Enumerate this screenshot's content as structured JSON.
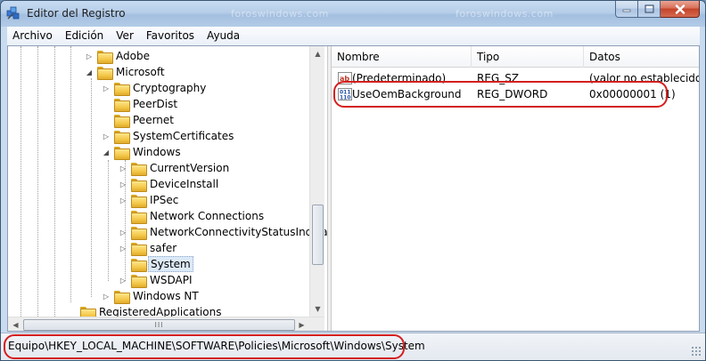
{
  "window": {
    "title": "Editor del Registro",
    "watermark": "foroswindows.com"
  },
  "menu": [
    "Archivo",
    "Edición",
    "Ver",
    "Favoritos",
    "Ayuda"
  ],
  "tree": {
    "items": [
      {
        "label": "Adobe",
        "expander": "collapsed",
        "selected": false
      },
      {
        "label": "Microsoft",
        "expander": "expanded",
        "selected": false
      },
      {
        "label": "Cryptography",
        "expander": "collapsed",
        "selected": false
      },
      {
        "label": "PeerDist",
        "expander": "none",
        "selected": false
      },
      {
        "label": "Peernet",
        "expander": "none",
        "selected": false
      },
      {
        "label": "SystemCertificates",
        "expander": "collapsed",
        "selected": false
      },
      {
        "label": "Windows",
        "expander": "expanded",
        "selected": false
      },
      {
        "label": "CurrentVersion",
        "expander": "collapsed",
        "selected": false
      },
      {
        "label": "DeviceInstall",
        "expander": "collapsed",
        "selected": false
      },
      {
        "label": "IPSec",
        "expander": "collapsed",
        "selected": false
      },
      {
        "label": "Network Connections",
        "expander": "none",
        "selected": false
      },
      {
        "label": "NetworkConnectivityStatusIndicat",
        "expander": "collapsed",
        "selected": false
      },
      {
        "label": "safer",
        "expander": "collapsed",
        "selected": false
      },
      {
        "label": "System",
        "expander": "none",
        "selected": true
      },
      {
        "label": "WSDAPI",
        "expander": "collapsed",
        "selected": false
      },
      {
        "label": "Windows NT",
        "expander": "collapsed",
        "selected": false
      },
      {
        "label": "RegisteredApplications",
        "expander": "none",
        "selected": false
      }
    ],
    "hscroll_thumb_label": "III"
  },
  "list": {
    "columns": [
      "Nombre",
      "Tipo",
      "Datos"
    ],
    "rows": [
      {
        "icon": "string-value-icon",
        "name": "(Predeterminado)",
        "type": "REG_SZ",
        "data": "(valor no establecido)"
      },
      {
        "icon": "binary-value-icon",
        "name": "UseOemBackground",
        "type": "REG_DWORD",
        "data": "0x00000001 (1)"
      }
    ]
  },
  "status": {
    "path": "Equipo\\HKEY_LOCAL_MACHINE\\SOFTWARE\\Policies\\Microsoft\\Windows\\System"
  },
  "colors": {
    "highlight": "#d41f1f",
    "selection": "#dce9f7"
  }
}
